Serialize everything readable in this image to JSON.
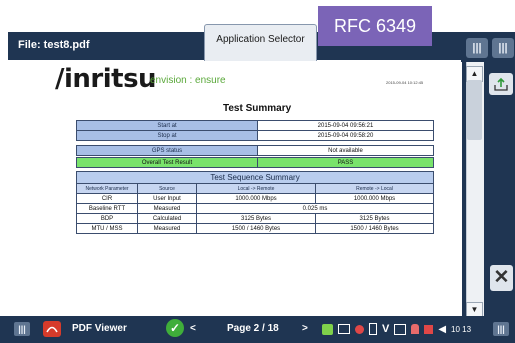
{
  "titlebar": {
    "file_title": "File: test8.pdf",
    "app_selector": "Application Selector"
  },
  "badge": {
    "text": "RFC 6349"
  },
  "document": {
    "logo": "/inritsu",
    "tagline": "envision : ensure",
    "timestamp": "2015-09-04 10:12:45",
    "title": "Test Summary",
    "summary_rows": [
      {
        "label": "Start at",
        "value": "2015-09-04 09:56:21"
      },
      {
        "label": "Stop at",
        "value": "2015-09-04 09:58:20"
      }
    ],
    "gps": {
      "label": "GPS status",
      "value": "Not available"
    },
    "result": {
      "label": "Overall Test Result",
      "value": "PASS"
    },
    "sequence": {
      "title": "Test Sequence Summary",
      "columns": [
        "Network Parameter",
        "Source",
        "Local -> Remote",
        "Remote -> Local"
      ],
      "rows": [
        {
          "param": "CIR",
          "source": "User Input",
          "lr": "1000.000 Mbps",
          "rl": "1000.000 Mbps"
        },
        {
          "param": "Baseline RTT",
          "source": "Measured",
          "merged": "0.025 ms"
        },
        {
          "param": "BDP",
          "source": "Calculated",
          "lr": "3125 Bytes",
          "rl": "3125 Bytes"
        },
        {
          "param": "MTU / MSS",
          "source": "Measured",
          "lr": "1500 / 1460 Bytes",
          "rl": "1500 / 1460 Bytes"
        }
      ]
    }
  },
  "bottombar": {
    "viewer_label": "PDF Viewer",
    "prev": "<",
    "page": "Page 2 / 18",
    "next": ">",
    "clock": "10 13"
  },
  "handles": {
    "glyph": "|||"
  },
  "icons": {
    "close": "✕",
    "scroll_up": "▲",
    "scroll_down": "▼",
    "check": "✓"
  },
  "colors": {
    "bar": "#1f3552",
    "badge": "#7b64b7",
    "pass": "#79e36b",
    "label_cell": "#a8bfe6"
  }
}
